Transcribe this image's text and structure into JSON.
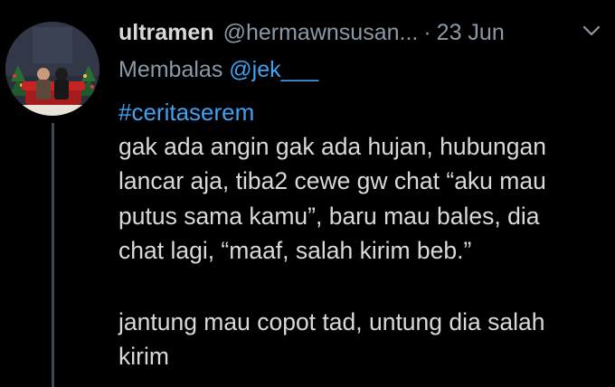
{
  "tweet": {
    "display_name": "ultramen",
    "handle": "@hermawnsusan...",
    "separator": "·",
    "date": "23 Jun",
    "reply_prefix": "Membalas",
    "reply_mention": "@jek___",
    "hashtag": "#ceritaserem",
    "body_lines": [
      "gak ada angin gak ada hujan, hubungan",
      "lancar aja, tiba2 cewe gw chat “aku mau",
      "putus sama kamu”, baru mau bales, dia",
      "chat lagi, “maaf, salah kirim beb.”",
      "",
      "jantung mau copot tad, untung dia salah",
      "kirim"
    ]
  },
  "icons": {
    "more": "chevron-down-icon"
  },
  "colors": {
    "background": "#000000",
    "text": "#d9d9d9",
    "secondary_text": "#8b99a6",
    "link": "#3fa2f2",
    "thread_line": "#3d4a55"
  }
}
